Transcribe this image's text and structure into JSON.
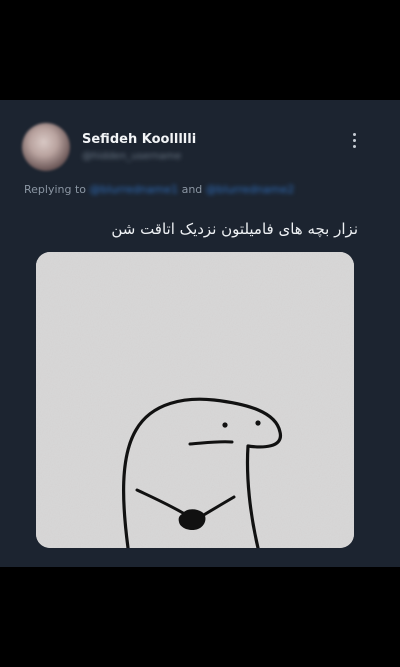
{
  "tweet": {
    "author_name": "Sefideh Koollllli",
    "author_handle": "@hidden_username",
    "more_icon": "more-vertical-icon",
    "reply": {
      "prefix": "Replying to",
      "mention_1": "@blurredname1",
      "conjunction": "and",
      "mention_2": "@blurredname2"
    },
    "text": "نزار بچه های فامیلتون نزدیک اتاقت شن",
    "media": {
      "kind": "meme-drawing",
      "description_icon": "flork-meme-illustration"
    }
  },
  "colors": {
    "background": "#000000",
    "card": "#1c2430",
    "name": "#f2f4f6",
    "muted": "#8b96a3",
    "link": "#2f6fbd",
    "media_bg": "#d9d8d8"
  }
}
